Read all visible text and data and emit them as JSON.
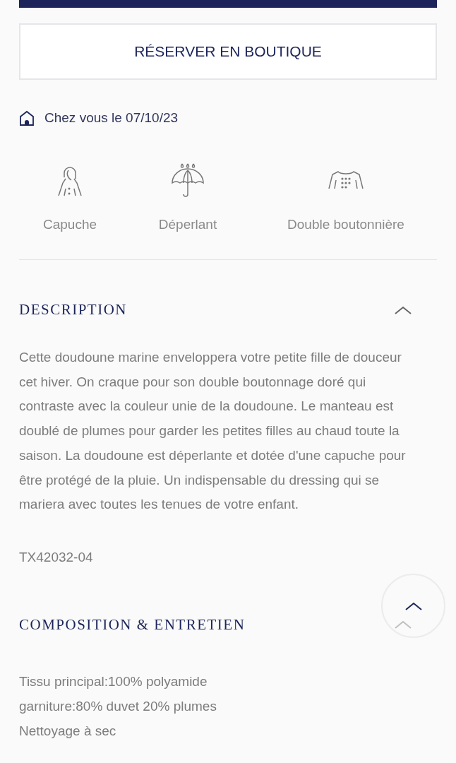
{
  "reserve_button": {
    "label": "RÉSERVER EN BOUTIQUE"
  },
  "delivery": {
    "text": "Chez vous le 07/10/23"
  },
  "features": [
    {
      "kind": "hood",
      "label": "Capuche"
    },
    {
      "kind": "umbrella",
      "label": "Déperlant"
    },
    {
      "kind": "coat",
      "label": "Double boutonnière"
    }
  ],
  "sections": [
    {
      "title": "DESCRIPTION",
      "expanded": true,
      "paragraphs": [
        "Cette doudoune marine enveloppera votre petite fille de douceur cet hiver. On craque pour son double boutonnage doré qui contraste avec la couleur unie de la doudoune. Le manteau est doublé de plumes pour garder les petites filles au chaud toute la saison. La doudoune est déperlante et dotée d'une capuche pour être protégé de la pluie. Un indispensable du dressing qui se mariera avec toutes les tenues de votre enfant.",
        "TX42032-04"
      ]
    },
    {
      "title": "COMPOSITION & ENTRETIEN",
      "expanded": true,
      "lines": [
        "Tissu principal:100% polyamide",
        "garniture:80% duvet 20% plumes",
        "Nettoyage à sec"
      ]
    }
  ]
}
